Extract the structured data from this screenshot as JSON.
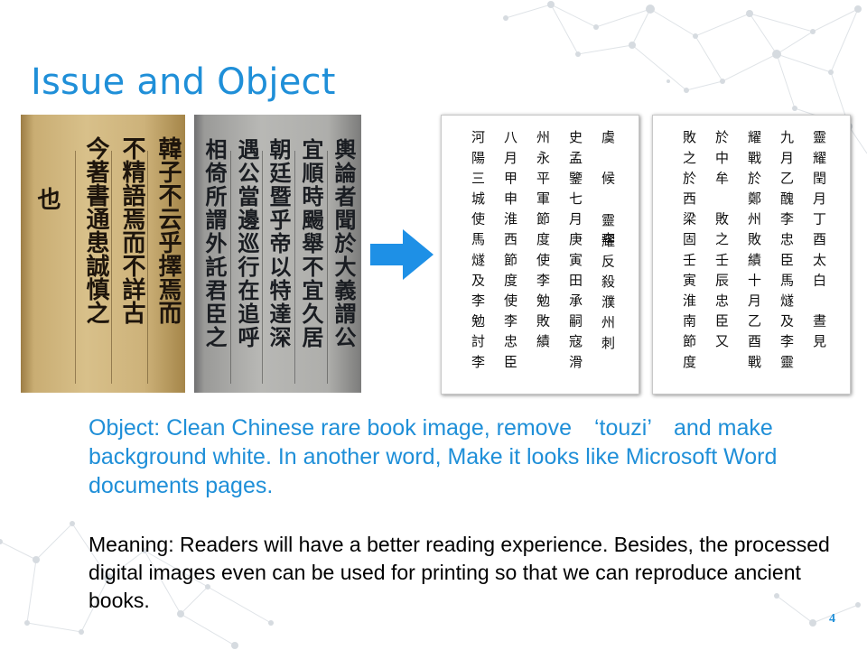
{
  "slide": {
    "title": "Issue and Object",
    "page_number": "4"
  },
  "scan_left": {
    "columns": [
      "韓子不云乎擇焉而",
      "不精語焉而不詳古",
      "今著書通患誠慎之",
      "也"
    ]
  },
  "scan_right": {
    "columns": [
      "輿論者聞於大義謂公",
      "宜順時颺舉不宜久居",
      "朝廷暨乎帝以特達深",
      "遇公當邊巡行在追呼",
      "相倚所謂外託君臣之"
    ]
  },
  "clean_page_1": {
    "columns": [
      "虞　候　　李",
      "史孟鑒七月庚寅田承嗣寇滑",
      "州永平軍節度使李勉敗績",
      "八月甲申淮西節度使李忠臣",
      "河陽三城使馬燧及李勉討李"
    ],
    "right_chars": "靈耀反殺濮州刺"
  },
  "clean_page_2": {
    "columns": [
      "靈耀閏月丁酉太白　晝見",
      "九月乙醜李忠臣馬燧及李靈",
      "耀戰於鄭州敗績十月乙酉戰",
      "於中牟　敗之壬辰忠臣又",
      "敗之於西梁固壬寅淮南節度"
    ]
  },
  "objective_text": "Object: Clean Chinese rare book image, remove　‘touzi’　and make background white. In another word, Make it looks like Microsoft Word documents pages.",
  "meaning_text": "Meaning: Readers will have a better reading experience. Besides, the processed digital images even can be used for printing so that we can reproduce ancient books.",
  "colors": {
    "accent_blue": "#1f8fd8",
    "arrow_blue": "#1e90e6"
  },
  "icons": {
    "arrow": "right-arrow-icon"
  }
}
